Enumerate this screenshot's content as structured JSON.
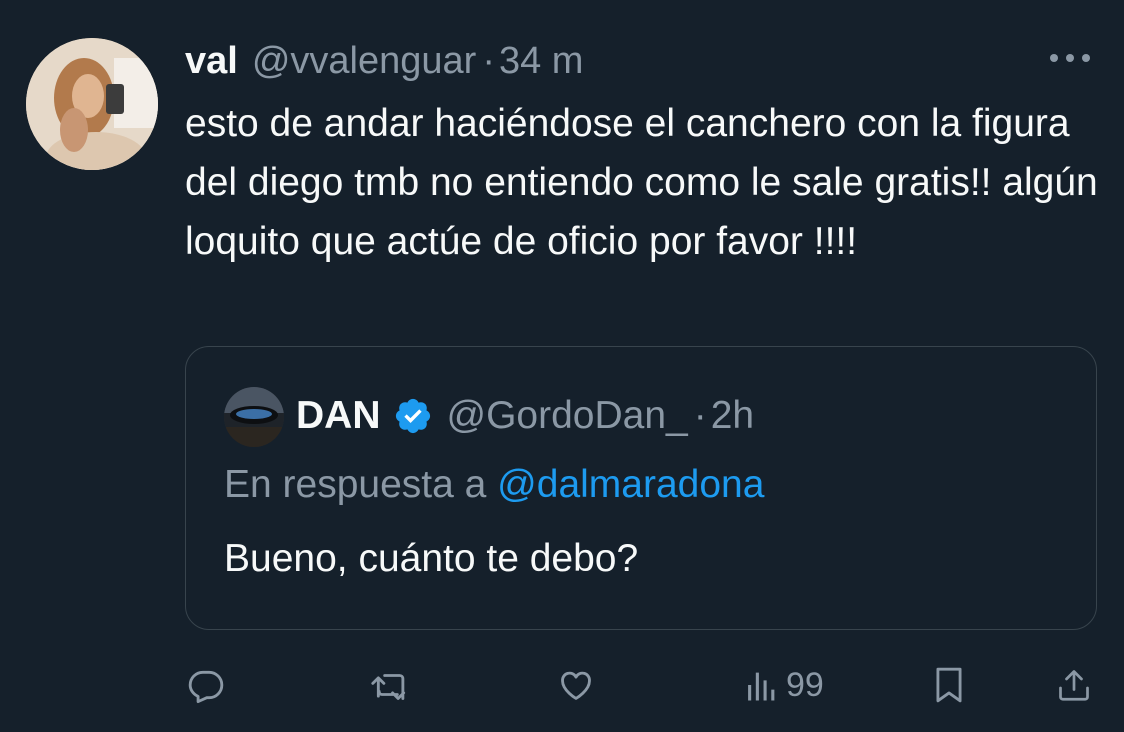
{
  "tweet": {
    "author": {
      "display_name": "val",
      "handle": "@vvalenguar",
      "avatar_icon": "avatar-photo"
    },
    "separator": "·",
    "time": "34 m",
    "text": "esto de andar haciéndose el canchero con la figura del diego tmb no entiendo como le sale gratis!! algún loquito que actúe de oficio por favor !!!!",
    "more_icon": "more-horizontal-icon"
  },
  "quote": {
    "author": {
      "display_name": "DAN",
      "handle": "@GordoDan_",
      "verified": true,
      "avatar_icon": "avatar-photo"
    },
    "separator": "·",
    "time": "2h",
    "reply_prefix": "En respuesta a ",
    "reply_mention": "@dalmaradona",
    "text": "Bueno, cuánto te debo?"
  },
  "actions": {
    "reply_icon": "reply-icon",
    "retweet_icon": "retweet-icon",
    "like_icon": "like-icon",
    "views_icon": "views-icon",
    "views_count": "99",
    "bookmark_icon": "bookmark-icon",
    "share_icon": "share-icon"
  },
  "colors": {
    "background": "#15202b",
    "text_primary": "#f7f9f9",
    "text_secondary": "#8b98a5",
    "accent": "#1d9bf0",
    "border": "#38444d"
  }
}
